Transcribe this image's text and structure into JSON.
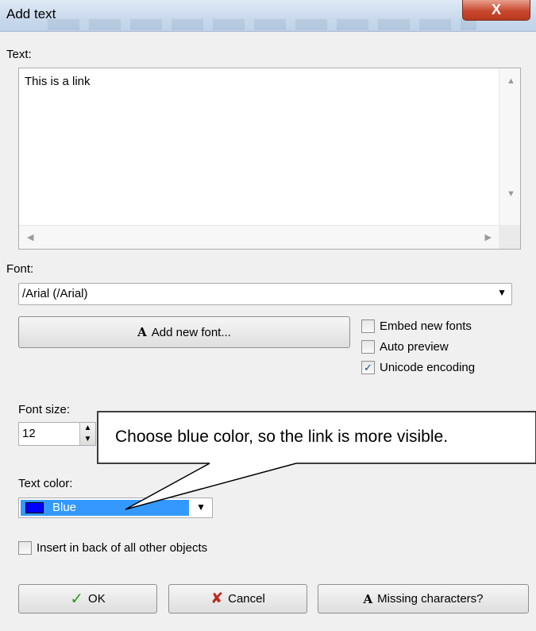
{
  "window": {
    "title": "Add text",
    "close_glyph": "X"
  },
  "text_section": {
    "label": "Text:",
    "value": "This is a link"
  },
  "font_section": {
    "label": "Font:",
    "selected": "/Arial (/Arial)",
    "add_button": "Add new font...",
    "add_button_glyph": "A"
  },
  "options": {
    "embed": {
      "label": "Embed new fonts",
      "checked": false
    },
    "preview": {
      "label": "Auto preview",
      "checked": false
    },
    "unicode": {
      "label": "Unicode encoding",
      "checked": true
    }
  },
  "font_size": {
    "label": "Font size:",
    "value": "12"
  },
  "text_color": {
    "label": "Text color:",
    "value": "Blue",
    "swatch": "#0000ff"
  },
  "insert_back": {
    "label": "Insert in back of all other objects",
    "checked": false
  },
  "buttons": {
    "ok": "OK",
    "cancel": "Cancel",
    "missing": "Missing characters?",
    "missing_glyph": "A"
  },
  "callout": {
    "text": "Choose blue color, so the link is more visible."
  },
  "colors": {
    "accent": "#3399ff",
    "close": "#c8482f",
    "ok_check": "#2a9d1a",
    "cancel_x": "#c0281e"
  }
}
